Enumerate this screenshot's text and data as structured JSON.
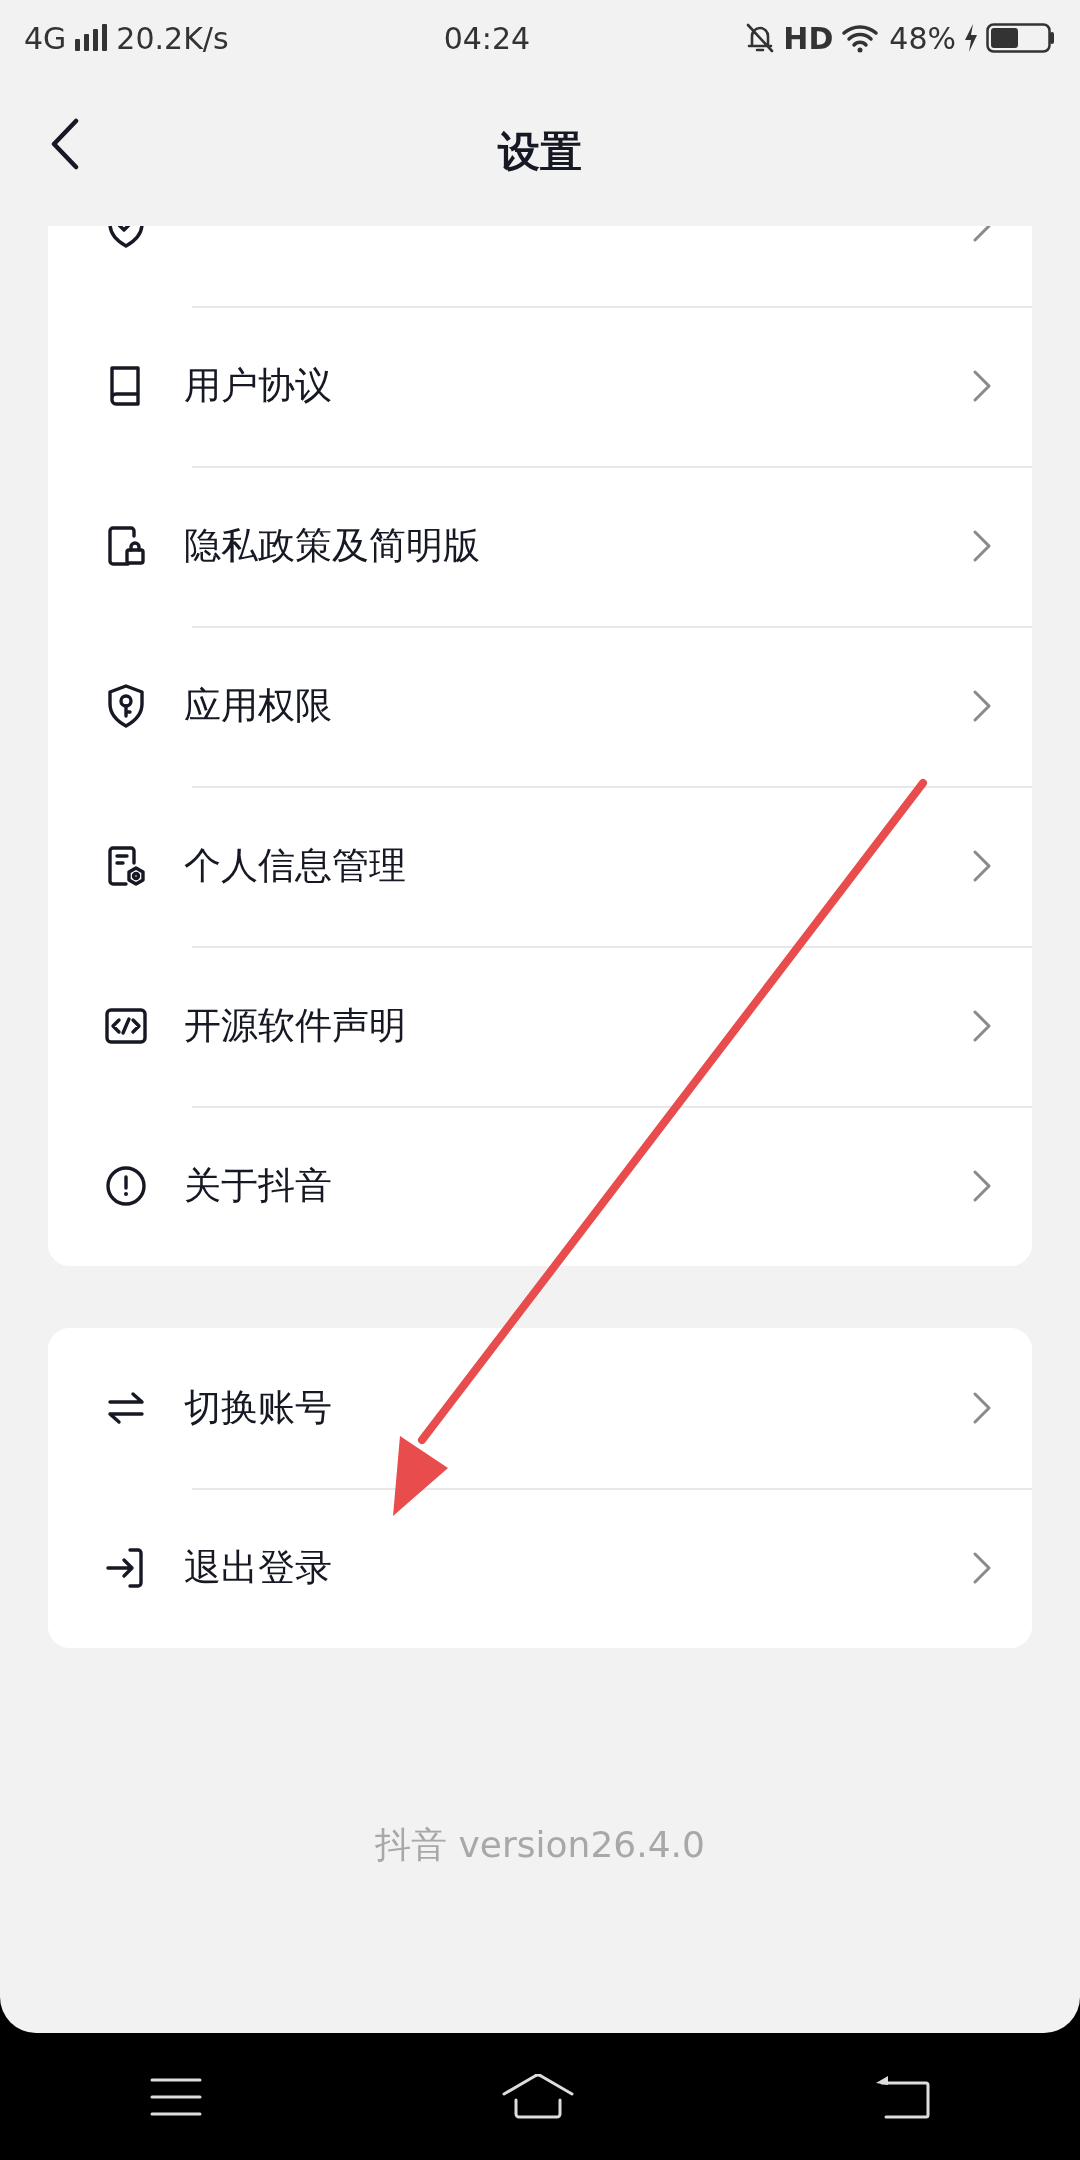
{
  "status_bar": {
    "network": "4G",
    "speed": "20.2K/s",
    "time": "04:24",
    "hd": "HD",
    "battery": "48%"
  },
  "header": {
    "title": "设置"
  },
  "groups": [
    {
      "items": [
        {
          "kind": "certificate"
        },
        {
          "kind": "book",
          "label": "用户协议"
        },
        {
          "kind": "privacy",
          "label": "隐私政策及简明版"
        },
        {
          "kind": "permission",
          "label": "应用权限"
        },
        {
          "kind": "personal",
          "label": "个人信息管理"
        },
        {
          "kind": "code",
          "label": "开源软件声明"
        },
        {
          "kind": "about",
          "label": "关于抖音"
        }
      ]
    },
    {
      "items": [
        {
          "kind": "switch",
          "label": "切换账号"
        },
        {
          "kind": "logout",
          "label": "退出登录"
        }
      ]
    }
  ],
  "footer": {
    "version": "抖音 version26.4.0"
  },
  "annotation": {
    "kind": "arrow",
    "color": "#e84c4c"
  }
}
